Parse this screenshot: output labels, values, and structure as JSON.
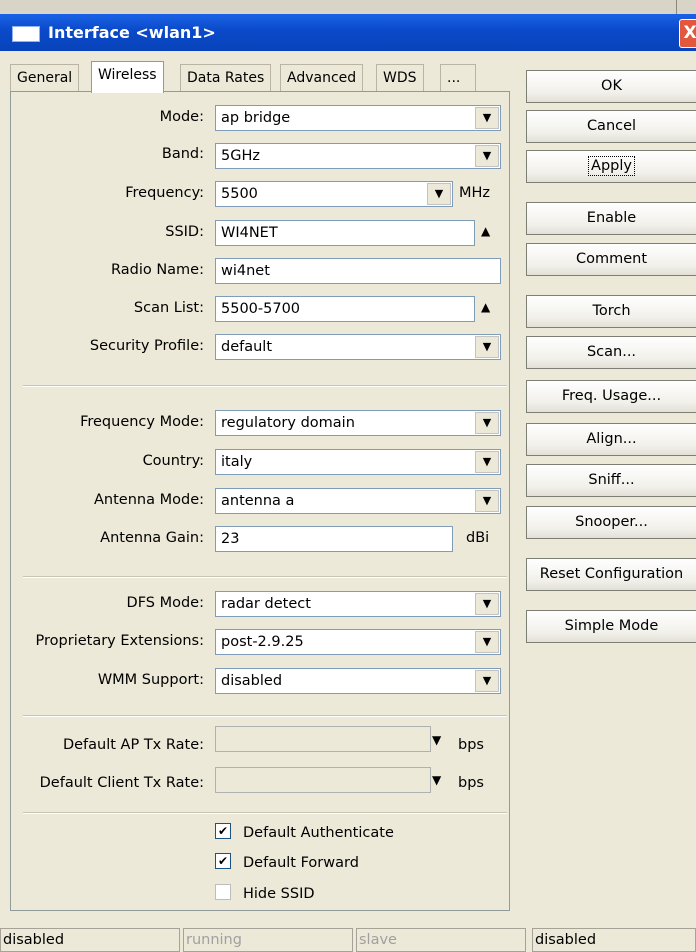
{
  "window": {
    "title": "Interface <wlan1>",
    "close_label": "X"
  },
  "tabs": [
    "General",
    "Wireless",
    "Data Rates",
    "Advanced",
    "WDS",
    "..."
  ],
  "active_tab": "Wireless",
  "form": {
    "mode": {
      "label": "Mode:",
      "value": "ap bridge"
    },
    "band": {
      "label": "Band:",
      "value": "5GHz"
    },
    "frequency": {
      "label": "Frequency:",
      "value": "5500",
      "unit": "MHz"
    },
    "ssid": {
      "label": "SSID:",
      "value": "WI4NET"
    },
    "radio_name": {
      "label": "Radio Name:",
      "value": "wi4net"
    },
    "scan_list": {
      "label": "Scan List:",
      "value": "5500-5700"
    },
    "security_profile": {
      "label": "Security Profile:",
      "value": "default"
    },
    "frequency_mode": {
      "label": "Frequency Mode:",
      "value": "regulatory domain"
    },
    "country": {
      "label": "Country:",
      "value": "italy"
    },
    "antenna_mode": {
      "label": "Antenna Mode:",
      "value": "antenna a"
    },
    "antenna_gain": {
      "label": "Antenna Gain:",
      "value": "23",
      "unit": "dBi"
    },
    "dfs_mode": {
      "label": "DFS Mode:",
      "value": "radar detect"
    },
    "proprietary_extensions": {
      "label": "Proprietary Extensions:",
      "value": "post-2.9.25"
    },
    "wmm_support": {
      "label": "WMM Support:",
      "value": "disabled"
    },
    "default_ap_tx_rate": {
      "label": "Default AP Tx Rate:",
      "value": "",
      "unit": "bps"
    },
    "default_client_tx_rate": {
      "label": "Default Client Tx Rate:",
      "value": "",
      "unit": "bps"
    },
    "default_authenticate": {
      "label": "Default Authenticate",
      "checked": true
    },
    "default_forward": {
      "label": "Default Forward",
      "checked": true
    },
    "hide_ssid": {
      "label": "Hide SSID",
      "checked": false
    }
  },
  "buttons": {
    "ok": "OK",
    "cancel": "Cancel",
    "apply": "Apply",
    "enable": "Enable",
    "comment": "Comment",
    "torch": "Torch",
    "scan": "Scan...",
    "freq_usage": "Freq. Usage...",
    "align": "Align...",
    "sniff": "Sniff...",
    "snooper": "Snooper...",
    "reset_configuration": "Reset Configuration",
    "simple_mode": "Simple Mode"
  },
  "status_bar": [
    "disabled",
    "running",
    "slave",
    "disabled"
  ],
  "icons": {
    "dropdown": "dropdown-arrow-icon",
    "expand": "expand-up-icon",
    "check": "checkmark-icon"
  }
}
